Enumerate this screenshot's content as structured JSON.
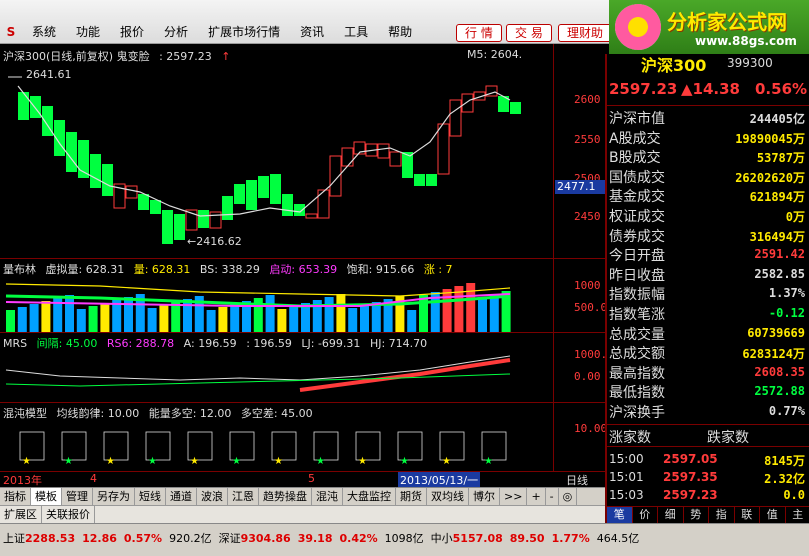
{
  "menu": {
    "items": [
      "系统",
      "功能",
      "报价",
      "分析",
      "扩展市场行情",
      "资讯",
      "工具",
      "帮助"
    ],
    "buttons": [
      "行 情",
      "交 易",
      "理财助"
    ]
  },
  "brand": {
    "name": "分析家公式网",
    "url": "www.88gs.com"
  },
  "main_chart": {
    "title": "沪深300(日线,前复权) 鬼变脸",
    "value": ": 2597.23",
    "ma_label": "M5: 2604.",
    "high_label": "2641.61",
    "low_label": "←2416.62",
    "price_tag": "2477.1",
    "y_ticks": [
      "2600",
      "2550",
      "2500",
      "2450"
    ]
  },
  "panel2": {
    "name": "量布林",
    "items": [
      {
        "label": "虚拟量: 628.31",
        "color": "#dddddd"
      },
      {
        "label": "量: 628.31",
        "color": "#ffea00"
      },
      {
        "label": "BS: 338.29",
        "color": "#dddddd"
      },
      {
        "label": "启动: 653.39",
        "color": "#ff3bff"
      },
      {
        "label": "饱和: 915.66",
        "color": "#dddddd"
      },
      {
        "label": "涨 : 7",
        "color": "#ffea00"
      }
    ],
    "y_ticks": [
      "1000",
      "500.00"
    ]
  },
  "panel3": {
    "name": "MRS",
    "items": [
      {
        "label": "间隔: 45.00",
        "color": "#00ff40"
      },
      {
        "label": "RS6: 288.78",
        "color": "#ff3bff"
      },
      {
        "label": "A: 196.59",
        "color": "#dddddd"
      },
      {
        "label": ": 196.59",
        "color": "#dddddd"
      },
      {
        "label": "LJ: -699.31",
        "color": "#dddddd"
      },
      {
        "label": "HJ: 714.70",
        "color": "#dddddd"
      }
    ],
    "y_ticks": [
      "1000.00",
      "0.00"
    ]
  },
  "panel4": {
    "name": "混沌模型",
    "items": [
      {
        "label": "均线韵律: 10.00",
        "color": "#dddddd"
      },
      {
        "label": "能量多空: 12.00",
        "color": "#dddddd"
      },
      {
        "label": "多空差: 45.00",
        "color": "#dddddd"
      }
    ],
    "y_ticks": [
      "10.00"
    ]
  },
  "datebar": {
    "labels": [
      "2013年",
      "4",
      "5",
      "2013/05/13/一",
      "日线"
    ]
  },
  "tabs": [
    "指标",
    "模板",
    "管理",
    "另存为",
    "短线",
    "通道",
    "波浪",
    "江恩",
    "趋势操盘",
    "混沌",
    "大盘监控",
    "期货",
    "双均线",
    "博尔",
    ">>",
    "+",
    "-",
    "◎"
  ],
  "tabs2": [
    "扩展区",
    "关联报价"
  ],
  "status": {
    "sh_label": "上证",
    "sh_price": "2288.53",
    "sh_chg": "12.86",
    "sh_pct": "0.57%",
    "sh_amt": "920.2亿",
    "sz_label": "深证",
    "sz_price": "9304.86",
    "sz_chg": "39.18",
    "sz_pct": "0.42%",
    "sz_amt": "1098亿",
    "zx_label": "中小",
    "zx_price": "5157.08",
    "zx_chg": "89.50",
    "zx_pct": "1.77%",
    "zx_amt": "464.5亿"
  },
  "quote": {
    "name": "沪深300",
    "code": "399300",
    "price": "2597.23",
    "change": "▲14.38",
    "pct": "0.56%",
    "rows": [
      {
        "label": "沪深市值",
        "value": "244405亿",
        "color": "#dddddd"
      },
      {
        "label": "A股成交",
        "value": "19890045万",
        "color": "#ffea00"
      },
      {
        "label": "B股成交",
        "value": "53787万",
        "color": "#ffea00"
      },
      {
        "label": "国债成交",
        "value": "26202620万",
        "color": "#ffea00"
      },
      {
        "label": "基金成交",
        "value": "621894万",
        "color": "#ffea00"
      },
      {
        "label": "权证成交",
        "value": "0万",
        "color": "#ffea00"
      },
      {
        "label": "债券成交",
        "value": "316494万",
        "color": "#ffea00"
      },
      {
        "label": "今日开盘",
        "value": "2591.42",
        "color": "#ff3b3b"
      },
      {
        "label": "昨日收盘",
        "value": "2582.85",
        "color": "#dddddd"
      },
      {
        "label": "指数振幅",
        "value": "1.37%",
        "color": "#dddddd"
      },
      {
        "label": "指数笔涨",
        "value": "-0.12",
        "color": "#00ff40"
      },
      {
        "label": "总成交量",
        "value": "60739669",
        "color": "#ffea00"
      },
      {
        "label": "总成交额",
        "value": "6283124万",
        "color": "#ffea00"
      },
      {
        "label": "最高指数",
        "value": "2608.35",
        "color": "#ff3b3b"
      },
      {
        "label": "最低指数",
        "value": "2572.88",
        "color": "#00ff40"
      },
      {
        "label": "沪深换手",
        "value": "0.77%",
        "color": "#dddddd"
      }
    ],
    "updown": {
      "up": "涨家数",
      "down": "跌家数"
    },
    "ticks": [
      {
        "time": "15:00",
        "price": "2597.05",
        "vol": "8145万"
      },
      {
        "time": "15:01",
        "price": "2597.35",
        "vol": "2.32亿"
      },
      {
        "time": "15:03",
        "price": "2597.23",
        "vol": "0.0"
      }
    ],
    "bottom_tabs": [
      "笔",
      "价",
      "细",
      "势",
      "指",
      "联",
      "值",
      "主"
    ]
  },
  "colors": {
    "up": "#ff3b3b",
    "down": "#00ff40",
    "bg": "#000000",
    "grid": "#7a0000"
  }
}
